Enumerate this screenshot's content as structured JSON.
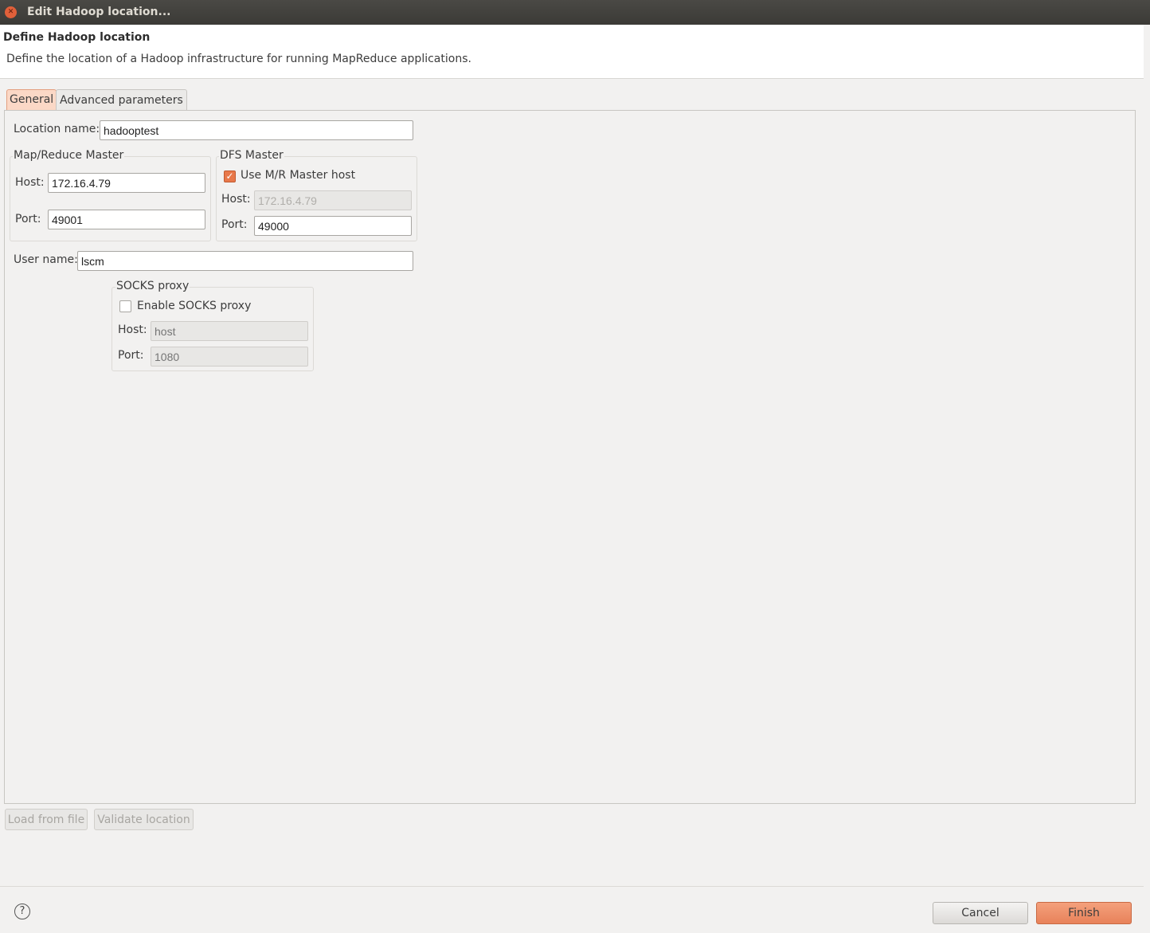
{
  "window": {
    "title": "Edit Hadoop location..."
  },
  "header": {
    "title": "Define Hadoop location",
    "description": "Define the location of a Hadoop infrastructure for running MapReduce applications."
  },
  "tabs": [
    {
      "label": "General",
      "selected": true
    },
    {
      "label": "Advanced parameters",
      "selected": false
    }
  ],
  "general": {
    "location_name_label": "Location name:",
    "location_name": "hadooptest",
    "mr_master": {
      "title": "Map/Reduce Master",
      "host_label": "Host:",
      "host": "172.16.4.79",
      "port_label": "Port:",
      "port": "49001"
    },
    "dfs_master": {
      "title": "DFS Master",
      "use_mr_label": "Use M/R Master host",
      "use_mr_checked": true,
      "host_label": "Host:",
      "host": "172.16.4.79",
      "port_label": "Port:",
      "port": "49000"
    },
    "user_name_label": "User name:",
    "user_name": "lscm",
    "socks": {
      "title": "SOCKS proxy",
      "enable_label": "Enable SOCKS proxy",
      "enabled": false,
      "host_label": "Host:",
      "host_placeholder": "host",
      "port_label": "Port:",
      "port_placeholder": "1080"
    }
  },
  "actions": {
    "load": "Load from file",
    "validate": "Validate location"
  },
  "footer": {
    "cancel": "Cancel",
    "finish": "Finish",
    "help_icon": "?"
  },
  "colors": {
    "accent": "#e8825a"
  }
}
